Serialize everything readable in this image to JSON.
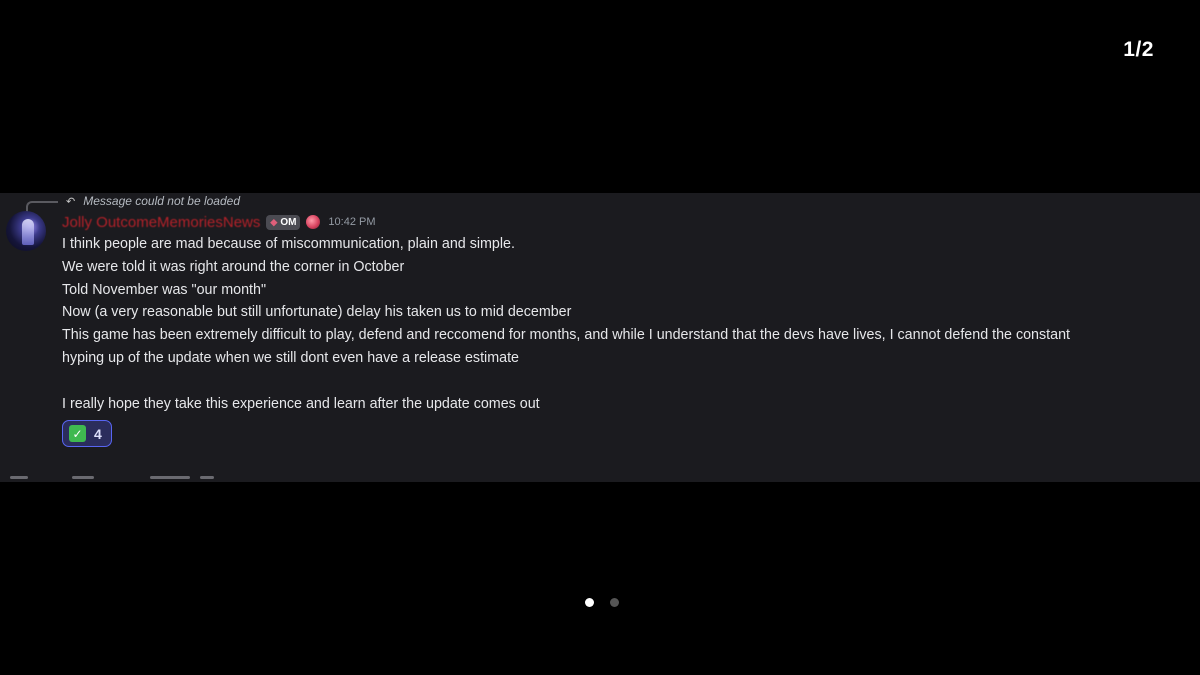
{
  "viewer": {
    "page_counter": "1/2",
    "pages": [
      {
        "active": true
      },
      {
        "active": false
      }
    ]
  },
  "message": {
    "reply_context": "Message could not be loaded",
    "author": "Jolly OutcomeMemoriesNews",
    "role_tag": "OM",
    "timestamp": "10:42 PM",
    "lines": [
      "I think people are mad because of miscommunication, plain and simple.",
      "We were told it was right around the corner in October",
      "Told November was \"our month\"",
      "Now (a very reasonable but still unfortunate) delay his taken us to mid december",
      "This game has been extremely difficult to play, defend and reccomend for months, and while I understand that the devs have lives, I cannot defend the constant",
      "hyping up of the update when we still dont even have a release estimate",
      "",
      "I really hope they take this experience and learn after the update comes out"
    ],
    "reaction": {
      "emoji": "white-check-mark",
      "count": "4"
    }
  },
  "colors": {
    "background": "#000000",
    "panel": "#1b1b1f",
    "username": "#c4222a",
    "reaction_border": "#5865f2",
    "check_green": "#3fb950"
  }
}
